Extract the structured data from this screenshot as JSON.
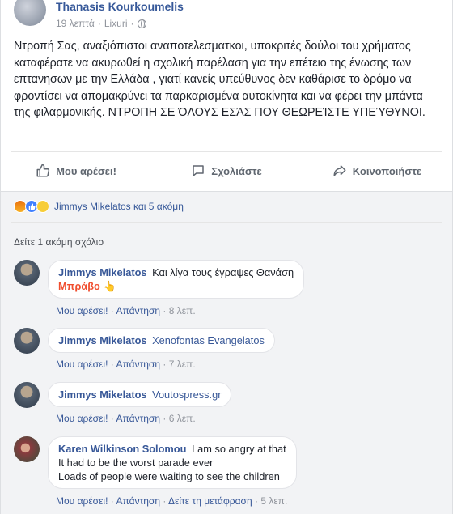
{
  "post": {
    "author": "Thanasis Kourkoumelis",
    "time": "19 λεπτά",
    "location": "Lixuri",
    "text": "Ντροπή Σας, αναξιόπιστοι αναποτελεσματκοι, υποκριτές δούλοι του χρήματος καταφέρατε να ακυρωθεί η σχολική παρέλαση για την επέτειο της ένωσης των επτανησων με την Ελλάδα , γιατί κανείς υπεύθυνος δεν καθάρισε το δρόμο να φροντίσει να απομακρύνει τα παρκαρισμένα αυτοκίνητα και να φέρει την μπάντα της φιλαρμονικής. ΝΤΡΟΠΗ ΣΕ ΌΛΟΥΣ ΕΣΆΣ ΠΟΥ ΘΕΩΡΕΊΣΤΕ ΥΠΕΎΘΥΝΟΙ."
  },
  "actions": {
    "like": "Μου αρέσει!",
    "comment": "Σχολιάστε",
    "share": "Κοινοποιήστε"
  },
  "reactions": {
    "icons": [
      "angry-emoji",
      "like-thumb",
      "sad-emoji"
    ],
    "summary": "Jimmys Mikelatos και 5 ακόμη"
  },
  "more_comments": "Δείτε 1 ακόμη σχόλιο",
  "comments": [
    {
      "author": "Jimmys Mikelatos",
      "line1": "Και λίγα τους έγραψες Θανάση",
      "line2": "Μπράβο",
      "emoji": "👆",
      "like": "Μου αρέσει!",
      "reply": "Απάντηση",
      "time": "8 λεπ."
    },
    {
      "author": "Jimmys Mikelatos",
      "line1": "Xenofontas Evangelatos",
      "like": "Μου αρέσει!",
      "reply": "Απάντηση",
      "time": "7 λεπ."
    },
    {
      "author": "Jimmys Mikelatos",
      "line1": "Voutospress.gr",
      "like": "Μου αρέσει!",
      "reply": "Απάντηση",
      "time": "6 λεπ."
    },
    {
      "author": "Karen Wilkinson Solomou",
      "line1": "I am so angry at that",
      "line2": "It had to be the worst parade ever",
      "line3": "Loads of people were waiting to see the children",
      "like": "Μου αρέσει!",
      "reply": "Απάντηση",
      "translate": "Δείτε τη μετάφραση",
      "time": "5 λεπ."
    }
  ],
  "separator": "·",
  "colors": {
    "link": "#365899",
    "muted": "#90949c",
    "bravo": "#f04e2f",
    "comments_bg": "#f2f3f5"
  }
}
